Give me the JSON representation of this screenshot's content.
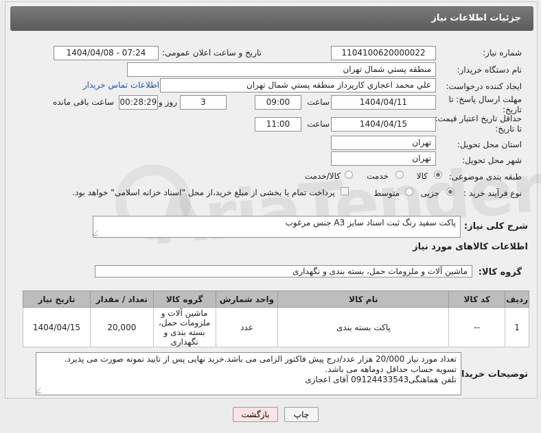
{
  "window": {
    "title": "جزئیات اطلاعات نیاز"
  },
  "form": {
    "need_number_label": "شماره نیاز:",
    "need_number": "1104100620000022",
    "announce_label": "تاریخ و ساعت اعلان عمومی:",
    "announce_value": "1404/04/08 - 07:24",
    "buyer_org_label": "نام دستگاه خریدار:",
    "buyer_org": "منطقه پستي شمال تهران",
    "requester_label": "ایجاد کننده درخواست:",
    "requester": "علي محمد اعجازي کارپرداز منطقه پستي شمال تهران",
    "contact_link": "اطلاعات تماس خریدار",
    "deadline_label_1": "مهلت ارسال پاسخ: تا",
    "deadline_label_2": "تاریخ:",
    "deadline_date": "1404/04/11",
    "time_label": "ساعت",
    "deadline_time": "09:00",
    "days_value": "3",
    "days_label": "روز و",
    "remaining_time": "00:28:29",
    "remaining_label": "ساعت باقی مانده",
    "min_validity_label_1": "حداقل تاریخ اعتبار قیمت:",
    "min_validity_label_2": "تا تاریخ:",
    "validity_date": "1404/04/15",
    "validity_time": "11:00",
    "province_label": "استان محل تحویل:",
    "province": "تهران",
    "city_label": "شهر محل تحویل:",
    "city": "تهران",
    "category_label": "طبقه بندی موضوعی:",
    "category_options": [
      "کالا",
      "خدمت",
      "کالا/خدمت"
    ],
    "category_selected": "کالا",
    "process_label": "نوع فرآیند خرید :",
    "process_options": [
      "جزیی",
      "متوسط"
    ],
    "process_selected": "جزیی",
    "payment_note": "پرداخت تمام یا بخشی از مبلغ خرید،از محل \"اسناد خزانه اسلامی\" خواهد بود.",
    "description_label": "شرح کلی نیاز:",
    "description": "پاکت سفید رنگ ثبت اسناد سایز A3 جنس مرغوب",
    "goods_info_heading": "اطلاعات کالاهای مورد نیاز",
    "goods_group_label": "گروه کالا:",
    "goods_group": "ماشین آلات و ملزومات حمل، بسته بندی و نگهداری",
    "buyer_notes_label": "توضیحات خریدار:",
    "buyer_notes": [
      "تعداد مورد نیاز 20/000 هزار عدد/درج پیش فاکتور الزامی می باشد.خرید نهایی پس از تایید نمونه صورت می پذیرد.",
      "تسویه حساب حداقل دوماهه می باشد.",
      "تلفن هماهنگی09124433543 آقای اعجازی"
    ]
  },
  "table": {
    "headers": [
      "ردیف",
      "کد کالا",
      "نام کالا",
      "واحد شمارش",
      "گروه کالا",
      "تعداد / مقدار",
      "تاریخ نیاز"
    ],
    "rows": [
      [
        "1",
        "--",
        "پاکت بسته بندی",
        "عدد",
        "ماشین آلات و ملزومات حمل، بسته بندی و نگهداری",
        "20,000",
        "1404/04/15"
      ]
    ]
  },
  "buttons": {
    "print": "چاپ",
    "back": "بازگشت"
  },
  "watermark": "AriaTender.net",
  "colors": {
    "back_button_bg": "#fde3e3",
    "link": "#1a56b8",
    "header_bg": "#6a6a6a"
  }
}
